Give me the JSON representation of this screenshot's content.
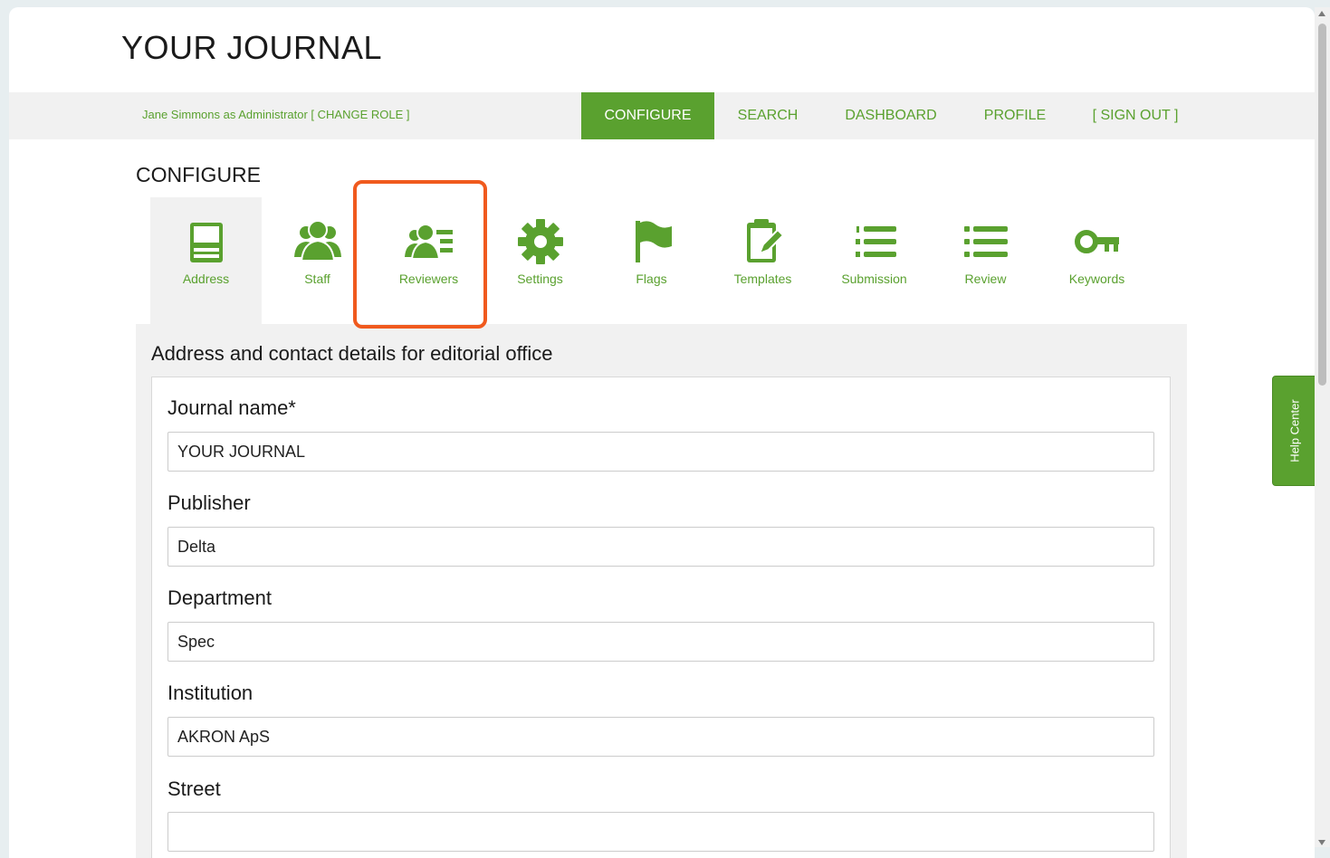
{
  "header": {
    "title": "YOUR JOURNAL"
  },
  "navbar": {
    "user_text": "Jane Simmons as Administrator [ CHANGE ROLE ]",
    "items": [
      {
        "label": "CONFIGURE",
        "active": true
      },
      {
        "label": "SEARCH"
      },
      {
        "label": "DASHBOARD"
      },
      {
        "label": "PROFILE"
      },
      {
        "label": "[ SIGN OUT ]"
      }
    ]
  },
  "configure": {
    "title": "CONFIGURE",
    "tabs": [
      {
        "label": "Address",
        "icon": "address-book-icon",
        "active": true
      },
      {
        "label": "Staff",
        "icon": "staff-group-icon"
      },
      {
        "label": "Reviewers",
        "icon": "reviewers-icon",
        "highlighted": true
      },
      {
        "label": "Settings",
        "icon": "gear-icon"
      },
      {
        "label": "Flags",
        "icon": "flag-icon"
      },
      {
        "label": "Templates",
        "icon": "clipboard-pencil-icon"
      },
      {
        "label": "Submission",
        "icon": "numbered-list-icon"
      },
      {
        "label": "Review",
        "icon": "bullet-list-icon"
      },
      {
        "label": "Keywords",
        "icon": "key-icon"
      }
    ]
  },
  "form": {
    "heading": "Address and contact details for editorial office",
    "fields": [
      {
        "label": "Journal name*",
        "value": "YOUR JOURNAL"
      },
      {
        "label": "Publisher",
        "value": "Delta"
      },
      {
        "label": "Department",
        "value": "Spec"
      },
      {
        "label": "Institution",
        "value": "AKRON ApS"
      },
      {
        "label": "Street",
        "value": ""
      }
    ]
  },
  "help_center": {
    "label": "Help Center"
  },
  "colors": {
    "accent": "#5aa12f",
    "highlight": "#f05a1e"
  }
}
